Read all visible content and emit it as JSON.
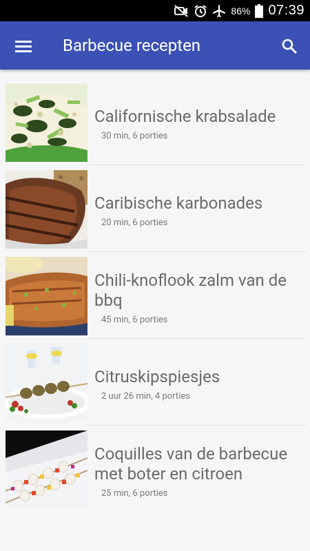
{
  "status_bar": {
    "icons": [
      "mute-icon",
      "alarm-icon",
      "airplane-mode-icon",
      "battery-icon"
    ],
    "battery_percent": "86%",
    "time": "07:39"
  },
  "app_bar": {
    "title": "Barbecue recepten",
    "color": "#3b51b5",
    "left_icon": "menu-icon",
    "right_icon": "search-icon"
  },
  "recipes": [
    {
      "name": "Californische krabsalade",
      "meta": "30 min, 6 porties",
      "image": "crab-salad-photo"
    },
    {
      "name": "Caribische karbonades",
      "meta": "20 min, 6 porties",
      "image": "grilled-chop-photo"
    },
    {
      "name": "Chili-knoflook zalm van de bbq",
      "meta": "45 min, 6 porties",
      "image": "grilled-salmon-photo"
    },
    {
      "name": "Citruskipspiesjes",
      "meta": "2 uur 26 min, 4 porties",
      "image": "chicken-skewers-photo"
    },
    {
      "name": "Coquilles van de barbecue met boter en citroen",
      "meta": "25 min, 6 porties",
      "image": "scallop-skewers-photo"
    }
  ]
}
